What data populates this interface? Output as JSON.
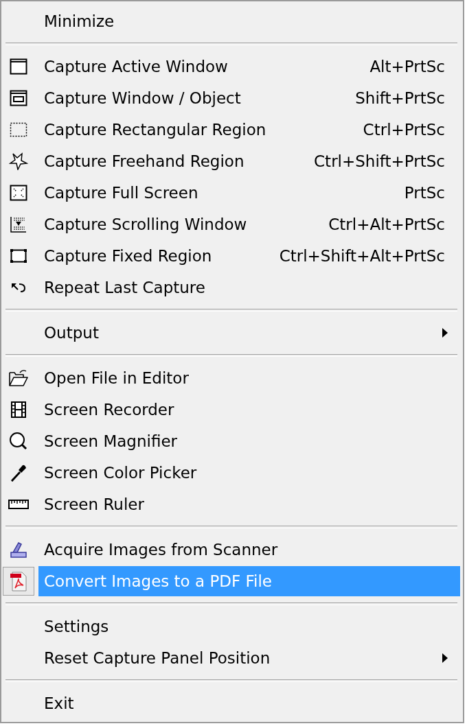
{
  "menu": {
    "sections": [
      {
        "items": [
          {
            "label": "Minimize",
            "submenu": false,
            "selected": false
          }
        ]
      },
      {
        "items": [
          {
            "label": "Capture Active Window",
            "shortcut": "Alt+PrtSc",
            "submenu": false,
            "selected": false
          },
          {
            "label": "Capture Window / Object",
            "shortcut": "Shift+PrtSc",
            "submenu": false,
            "selected": false
          },
          {
            "label": "Capture Rectangular Region",
            "shortcut": "Ctrl+PrtSc",
            "submenu": false,
            "selected": false
          },
          {
            "label": "Capture Freehand Region",
            "shortcut": "Ctrl+Shift+PrtSc",
            "submenu": false,
            "selected": false
          },
          {
            "label": "Capture Full Screen",
            "shortcut": "PrtSc",
            "submenu": false,
            "selected": false
          },
          {
            "label": "Capture Scrolling Window",
            "shortcut": "Ctrl+Alt+PrtSc",
            "submenu": false,
            "selected": false
          },
          {
            "label": "Capture Fixed Region",
            "shortcut": "Ctrl+Shift+Alt+PrtSc",
            "submenu": false,
            "selected": false
          },
          {
            "label": "Repeat Last Capture",
            "submenu": false,
            "selected": false
          }
        ]
      },
      {
        "items": [
          {
            "label": "Output",
            "submenu": true,
            "selected": false
          }
        ]
      },
      {
        "items": [
          {
            "label": "Open File in Editor",
            "submenu": false,
            "selected": false
          },
          {
            "label": "Screen Recorder",
            "submenu": false,
            "selected": false
          },
          {
            "label": "Screen Magnifier",
            "submenu": false,
            "selected": false
          },
          {
            "label": "Screen Color Picker",
            "submenu": false,
            "selected": false
          },
          {
            "label": "Screen Ruler",
            "submenu": false,
            "selected": false
          }
        ]
      },
      {
        "items": [
          {
            "label": "Acquire Images from Scanner",
            "submenu": false,
            "selected": false
          },
          {
            "label": "Convert Images to a PDF File",
            "submenu": false,
            "selected": true
          }
        ]
      },
      {
        "items": [
          {
            "label": "Settings",
            "submenu": false,
            "selected": false
          },
          {
            "label": "Reset Capture Panel Position",
            "submenu": true,
            "selected": false
          }
        ]
      },
      {
        "items": [
          {
            "label": "Exit",
            "submenu": false,
            "selected": false
          }
        ]
      }
    ]
  }
}
